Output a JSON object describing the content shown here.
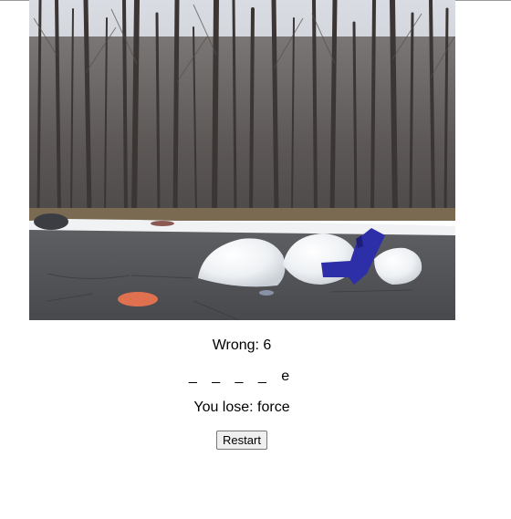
{
  "game": {
    "wrong_label": "Wrong: 6",
    "word_display": "_ _ _ _ e",
    "status_message": "You lose: force",
    "restart_label": "Restart"
  }
}
